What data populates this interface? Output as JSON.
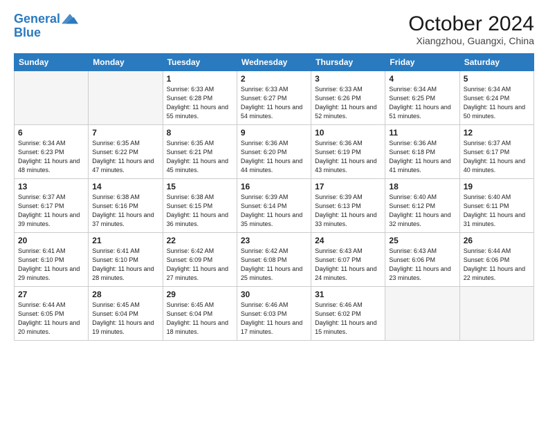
{
  "header": {
    "logo_line1": "General",
    "logo_line2": "Blue",
    "month_title": "October 2024",
    "location": "Xiangzhou, Guangxi, China"
  },
  "weekdays": [
    "Sunday",
    "Monday",
    "Tuesday",
    "Wednesday",
    "Thursday",
    "Friday",
    "Saturday"
  ],
  "weeks": [
    [
      {
        "day": "",
        "info": ""
      },
      {
        "day": "",
        "info": ""
      },
      {
        "day": "1",
        "info": "Sunrise: 6:33 AM\nSunset: 6:28 PM\nDaylight: 11 hours and 55 minutes."
      },
      {
        "day": "2",
        "info": "Sunrise: 6:33 AM\nSunset: 6:27 PM\nDaylight: 11 hours and 54 minutes."
      },
      {
        "day": "3",
        "info": "Sunrise: 6:33 AM\nSunset: 6:26 PM\nDaylight: 11 hours and 52 minutes."
      },
      {
        "day": "4",
        "info": "Sunrise: 6:34 AM\nSunset: 6:25 PM\nDaylight: 11 hours and 51 minutes."
      },
      {
        "day": "5",
        "info": "Sunrise: 6:34 AM\nSunset: 6:24 PM\nDaylight: 11 hours and 50 minutes."
      }
    ],
    [
      {
        "day": "6",
        "info": "Sunrise: 6:34 AM\nSunset: 6:23 PM\nDaylight: 11 hours and 48 minutes."
      },
      {
        "day": "7",
        "info": "Sunrise: 6:35 AM\nSunset: 6:22 PM\nDaylight: 11 hours and 47 minutes."
      },
      {
        "day": "8",
        "info": "Sunrise: 6:35 AM\nSunset: 6:21 PM\nDaylight: 11 hours and 45 minutes."
      },
      {
        "day": "9",
        "info": "Sunrise: 6:36 AM\nSunset: 6:20 PM\nDaylight: 11 hours and 44 minutes."
      },
      {
        "day": "10",
        "info": "Sunrise: 6:36 AM\nSunset: 6:19 PM\nDaylight: 11 hours and 43 minutes."
      },
      {
        "day": "11",
        "info": "Sunrise: 6:36 AM\nSunset: 6:18 PM\nDaylight: 11 hours and 41 minutes."
      },
      {
        "day": "12",
        "info": "Sunrise: 6:37 AM\nSunset: 6:17 PM\nDaylight: 11 hours and 40 minutes."
      }
    ],
    [
      {
        "day": "13",
        "info": "Sunrise: 6:37 AM\nSunset: 6:17 PM\nDaylight: 11 hours and 39 minutes."
      },
      {
        "day": "14",
        "info": "Sunrise: 6:38 AM\nSunset: 6:16 PM\nDaylight: 11 hours and 37 minutes."
      },
      {
        "day": "15",
        "info": "Sunrise: 6:38 AM\nSunset: 6:15 PM\nDaylight: 11 hours and 36 minutes."
      },
      {
        "day": "16",
        "info": "Sunrise: 6:39 AM\nSunset: 6:14 PM\nDaylight: 11 hours and 35 minutes."
      },
      {
        "day": "17",
        "info": "Sunrise: 6:39 AM\nSunset: 6:13 PM\nDaylight: 11 hours and 33 minutes."
      },
      {
        "day": "18",
        "info": "Sunrise: 6:40 AM\nSunset: 6:12 PM\nDaylight: 11 hours and 32 minutes."
      },
      {
        "day": "19",
        "info": "Sunrise: 6:40 AM\nSunset: 6:11 PM\nDaylight: 11 hours and 31 minutes."
      }
    ],
    [
      {
        "day": "20",
        "info": "Sunrise: 6:41 AM\nSunset: 6:10 PM\nDaylight: 11 hours and 29 minutes."
      },
      {
        "day": "21",
        "info": "Sunrise: 6:41 AM\nSunset: 6:10 PM\nDaylight: 11 hours and 28 minutes."
      },
      {
        "day": "22",
        "info": "Sunrise: 6:42 AM\nSunset: 6:09 PM\nDaylight: 11 hours and 27 minutes."
      },
      {
        "day": "23",
        "info": "Sunrise: 6:42 AM\nSunset: 6:08 PM\nDaylight: 11 hours and 25 minutes."
      },
      {
        "day": "24",
        "info": "Sunrise: 6:43 AM\nSunset: 6:07 PM\nDaylight: 11 hours and 24 minutes."
      },
      {
        "day": "25",
        "info": "Sunrise: 6:43 AM\nSunset: 6:06 PM\nDaylight: 11 hours and 23 minutes."
      },
      {
        "day": "26",
        "info": "Sunrise: 6:44 AM\nSunset: 6:06 PM\nDaylight: 11 hours and 22 minutes."
      }
    ],
    [
      {
        "day": "27",
        "info": "Sunrise: 6:44 AM\nSunset: 6:05 PM\nDaylight: 11 hours and 20 minutes."
      },
      {
        "day": "28",
        "info": "Sunrise: 6:45 AM\nSunset: 6:04 PM\nDaylight: 11 hours and 19 minutes."
      },
      {
        "day": "29",
        "info": "Sunrise: 6:45 AM\nSunset: 6:04 PM\nDaylight: 11 hours and 18 minutes."
      },
      {
        "day": "30",
        "info": "Sunrise: 6:46 AM\nSunset: 6:03 PM\nDaylight: 11 hours and 17 minutes."
      },
      {
        "day": "31",
        "info": "Sunrise: 6:46 AM\nSunset: 6:02 PM\nDaylight: 11 hours and 15 minutes."
      },
      {
        "day": "",
        "info": ""
      },
      {
        "day": "",
        "info": ""
      }
    ]
  ]
}
